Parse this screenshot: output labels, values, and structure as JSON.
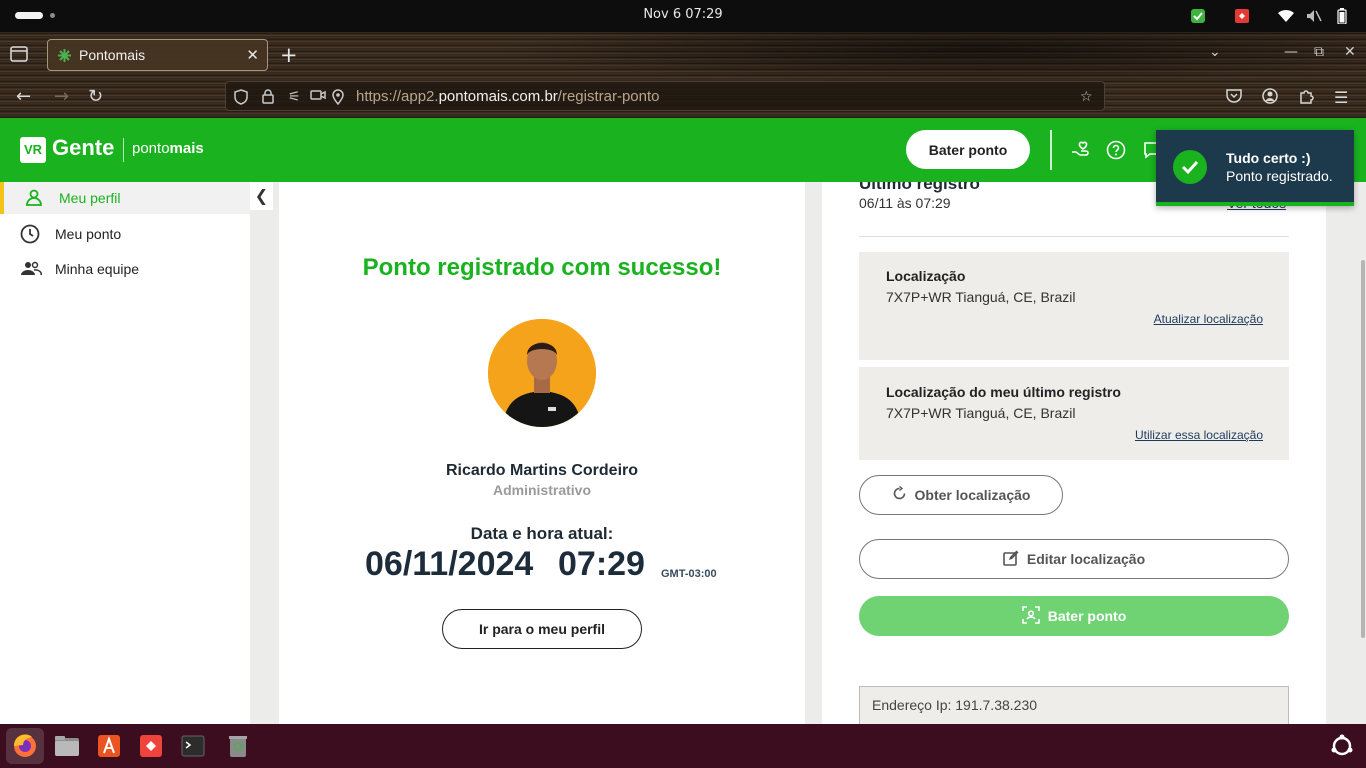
{
  "os": {
    "clock": "Nov 6  07:29"
  },
  "browser": {
    "tab_title": "Pontomais",
    "url_prefix": "https://app2.",
    "url_host": "pontomais.com.br",
    "url_path": "/registrar-ponto"
  },
  "header": {
    "logo_mark": "VR",
    "logo_gente": "Gente",
    "logo_brand_light": "ponto",
    "logo_brand_bold": "mais",
    "punch_button": "Bater ponto"
  },
  "sidebar": {
    "items": [
      {
        "label": "Meu perfil",
        "icon": "person-icon",
        "active": true
      },
      {
        "label": "Meu ponto",
        "icon": "clock-icon",
        "active": false
      },
      {
        "label": "Minha equipe",
        "icon": "team-icon",
        "active": false
      }
    ]
  },
  "main": {
    "success_title": "Ponto registrado com sucesso!",
    "user_name": "Ricardo Martins Cordeiro",
    "user_role": "Administrativo",
    "datetime_label": "Data e hora atual:",
    "date": "06/11/2024",
    "time": "07:29",
    "timezone": "GMT-03:00",
    "profile_button": "Ir para o meu perfil"
  },
  "right_panel": {
    "last_record_title": "Último registro",
    "last_record_time": "06/11 às 07:29",
    "see_all": "Ver todos",
    "location": {
      "title": "Localização",
      "address": "7X7P+WR Tianguá, CE, Brazil",
      "link": "Atualizar localização"
    },
    "last_location": {
      "title": "Localização do meu último registro",
      "address": "7X7P+WR Tianguá, CE, Brazil",
      "link": "Utilizar essa localização"
    },
    "obtain_button": "Obter localização",
    "edit_button": "Editar localização",
    "punch_button": "Bater ponto",
    "ip_text": "Endereço Ip: 191.7.38.230"
  },
  "toast": {
    "title": "Tudo certo :)",
    "message": "Ponto registrado."
  },
  "colors": {
    "brand_green": "#1ab21f",
    "toast_bg": "#1d3a4d",
    "accent_yellow": "#f3c318"
  }
}
